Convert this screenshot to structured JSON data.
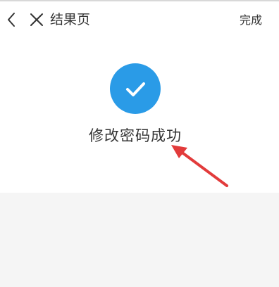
{
  "header": {
    "back_icon": "chevron-left-icon",
    "close_icon": "close-icon",
    "title": "结果页",
    "done_label": "完成"
  },
  "result": {
    "icon": "check-circle-icon",
    "status": "success",
    "message": "修改密码成功"
  },
  "colors": {
    "accent": "#2a9be7",
    "annotation_arrow": "#e23b3b",
    "text": "#333333",
    "page_background": "#f5f5f5"
  }
}
